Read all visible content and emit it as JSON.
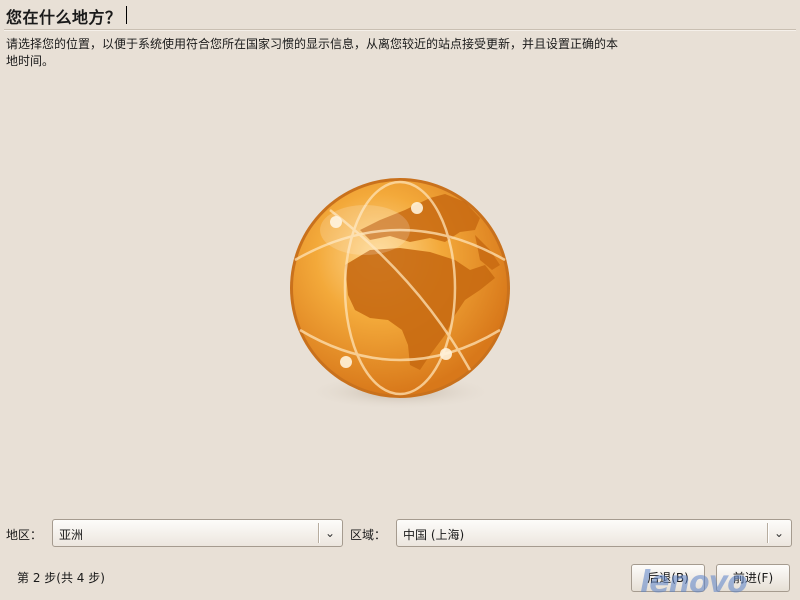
{
  "header": {
    "title": "您在什么地方？",
    "description": "请选择您的位置，以便于系统使用符合您所在国家习惯的显示信息，从离您较近的站点接受更新，并且设置正确的本地时间。"
  },
  "location": {
    "region_label": "地区：",
    "region_value": "亚洲",
    "zone_label": "区域：",
    "zone_value": "中国 (上海)"
  },
  "footer": {
    "step_text": "第 2 步(共 4 步)",
    "back_label": "后退(B)",
    "forward_label": "前进(F)"
  },
  "watermark": "lenovo",
  "icons": {
    "globe": "globe-icon",
    "dropdown": "chevron-down-icon"
  },
  "colors": {
    "background": "#e8e0d6",
    "globe_orange": "#f0a030"
  }
}
